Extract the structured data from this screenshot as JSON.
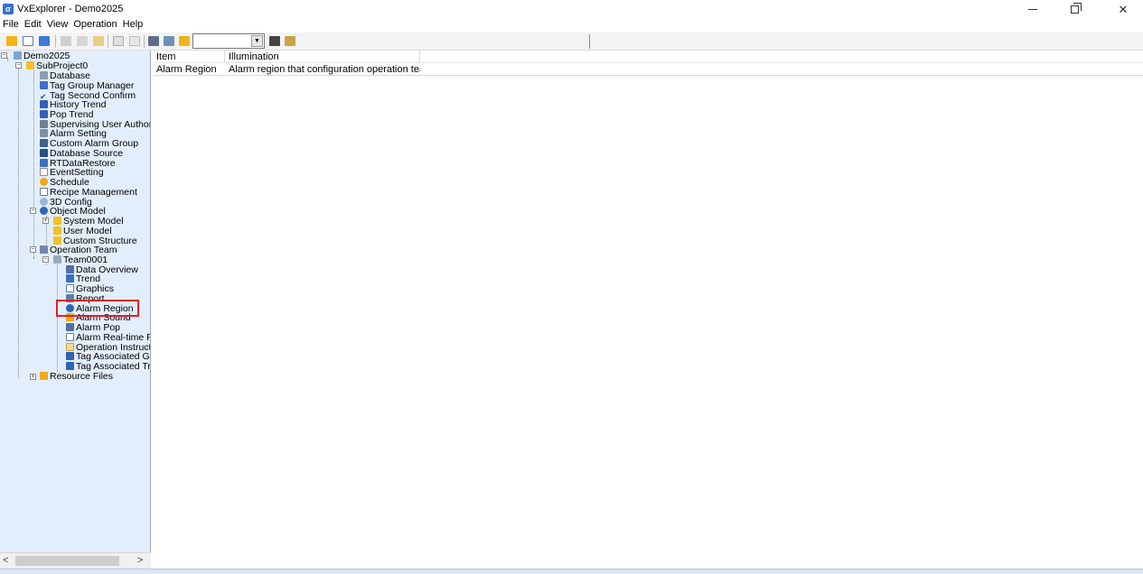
{
  "window": {
    "title": "VxExplorer - Demo2025"
  },
  "menu": [
    "File",
    "Edit",
    "View",
    "Operation",
    "Help"
  ],
  "toolbar": {
    "combo_value": ""
  },
  "tree": [
    {
      "label": "Demo2025",
      "icon": "project-icon"
    },
    {
      "label": "SubProject0",
      "icon": "folder-icon"
    },
    {
      "label": "Database",
      "icon": "database-icon"
    },
    {
      "label": "Tag Group Manager",
      "icon": "tag-group-icon"
    },
    {
      "label": "Tag Second Confirm",
      "icon": "check-icon"
    },
    {
      "label": "History Trend",
      "icon": "history-trend-icon"
    },
    {
      "label": "Pop Trend",
      "icon": "pop-trend-icon"
    },
    {
      "label": "Supervising User Authorit",
      "icon": "user-authority-icon"
    },
    {
      "label": "Alarm Setting",
      "icon": "alarm-setting-icon"
    },
    {
      "label": "Custom Alarm Group",
      "icon": "alarm-group-icon"
    },
    {
      "label": "Database Source",
      "icon": "database-source-icon"
    },
    {
      "label": "RTDataRestore",
      "icon": "restore-icon"
    },
    {
      "label": "EventSetting",
      "icon": "event-icon"
    },
    {
      "label": "Schedule",
      "icon": "schedule-icon"
    },
    {
      "label": "Recipe Management",
      "icon": "recipe-icon"
    },
    {
      "label": "3D Config",
      "icon": "3d-icon"
    },
    {
      "label": "Object Model",
      "icon": "object-model-icon"
    },
    {
      "label": "System Model",
      "icon": "folder-icon"
    },
    {
      "label": "User Model",
      "icon": "folder-icon"
    },
    {
      "label": "Custom Structure",
      "icon": "folder-icon"
    },
    {
      "label": "Operation Team",
      "icon": "operation-team-icon"
    },
    {
      "label": "Team0001",
      "icon": "team-icon"
    },
    {
      "label": "Data Overview",
      "icon": "data-overview-icon"
    },
    {
      "label": "Trend",
      "icon": "trend-icon"
    },
    {
      "label": "Graphics",
      "icon": "graphics-icon"
    },
    {
      "label": "Report",
      "icon": "report-icon"
    },
    {
      "label": "Alarm Region",
      "icon": "alarm-region-icon"
    },
    {
      "label": "Alarm Sound",
      "icon": "alarm-sound-icon"
    },
    {
      "label": "Alarm Pop",
      "icon": "alarm-pop-icon"
    },
    {
      "label": "Alarm Real-time Pri",
      "icon": "alarm-realtime-icon"
    },
    {
      "label": "Operation Instructi",
      "icon": "instruction-icon"
    },
    {
      "label": "Tag Associated Gra",
      "icon": "tag-graphics-icon"
    },
    {
      "label": "Tag Associated Tre",
      "icon": "tag-trend-icon"
    },
    {
      "label": "Resource Files",
      "icon": "resource-icon"
    }
  ],
  "list": {
    "columns": [
      "Item",
      "Illumination"
    ],
    "rows": [
      [
        "Alarm Region",
        "Alarm region that configuration operation tea..."
      ]
    ]
  },
  "colors": {
    "tree_bg": "#e3eefc",
    "highlight": "#e0202a",
    "folder": "#f2c027",
    "accent": "#2f6fd6"
  }
}
